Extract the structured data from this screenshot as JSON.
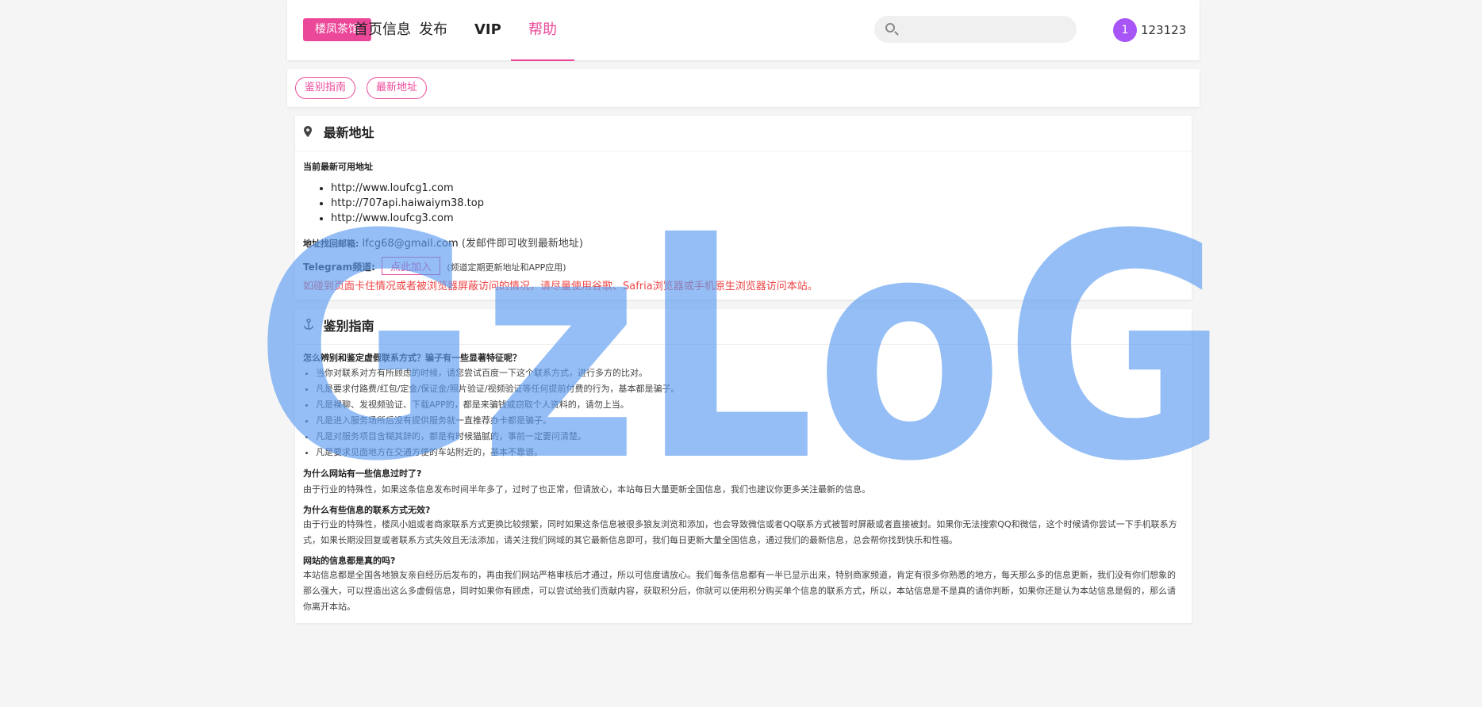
{
  "header": {
    "logo": "楼凤茶馆",
    "nav": [
      {
        "label": "首页信息"
      },
      {
        "label": "发布"
      },
      {
        "label": "VIP"
      },
      {
        "label": "帮助"
      }
    ],
    "search_placeholder": "",
    "avatar_badge": "1",
    "username": "123123"
  },
  "tabs": [
    "鉴别指南",
    "最新地址"
  ],
  "latest": {
    "title": "最新地址",
    "subtitle": "当前最新可用地址",
    "urls": [
      "http://www.loufcg1.com",
      "http://707api.haiwaiym38.top",
      "http://www.loufcg3.com"
    ],
    "email_label": "地址找回邮箱:",
    "email": "lfcg68@gmail.com",
    "email_note": "(发邮件即可收到最新地址)",
    "telegram_label": "Telegram频道:",
    "telegram_btn": "点此加入",
    "telegram_note": "(频道定期更新地址和APP应用)",
    "warning": "如碰到页面卡住情况或者被浏览器屏蔽访问的情况，请尽量使用谷歌、Safria浏览器或手机原生浏览器访问本站。"
  },
  "guide": {
    "title": "鉴别指南",
    "q1": "怎么辨别和鉴定虚假联系方式？骗子有一些显著特征呢？",
    "tips": [
      "当你对联系对方有所顾虑的时候，请您尝试百度一下这个联系方式，进行多方的比对。",
      "凡是要求付路费/红包/定金/保证金/照片验证/视频验证等任何提前付费的行为，基本都是骗子。",
      "凡是裸聊、发视频验证、下载APP的，都是来骗钱或窃取个人资料的，请勿上当。",
      "凡是进入服务场所后没有提供服务就一直推荐办卡都是骗子。",
      "凡是对服务项目含糊其辞的，都是有时候猫腻的，事前一定要问清楚。",
      "凡是要求见面地方在交通方便的车站附近的，基本不靠谱。"
    ],
    "q2": "为什么网站有一些信息过时了?",
    "a2": "由于行业的特殊性，如果这条信息发布时间半年多了，过时了也正常，但请放心，本站每日大量更新全国信息，我们也建议你更多关注最新的信息。",
    "q3": "为什么有些信息的联系方式无效?",
    "a3": "由于行业的特殊性，楼凤小姐或者商家联系方式更换比较频繁，同时如果这条信息被很多狼友浏览和添加，也会导致微信或者QQ联系方式被暂时屏蔽或者直接被封。如果你无法搜索QQ和微信，这个时候请你尝试一下手机联系方式，如果长期没回复或者联系方式失效且无法添加，请关注我们网域的其它最新信息即可，我们每日更新大量全国信息，通过我们的最新信息，总会帮你找到快乐和性福。",
    "q4": "网站的信息都是真的吗?",
    "a4": "本站信息都是全国各地狼友亲自经历后发布的，再由我们网站严格审核后才通过，所以可信度请放心。我们每条信息都有一半已显示出来，特别商家频道，肯定有很多你熟悉的地方，每天那么多的信息更新，我们没有你们想象的那么强大，可以捏造出这么多虚假信息，同时如果你有顾虑，可以尝试给我们贡献内容，获取积分后，你就可以使用积分购买单个信息的联系方式，所以，本站信息是不是真的请你判断，如果你还是认为本站信息是假的，那么请你离开本站。"
  },
  "watermark_text": "GzLoG",
  "colors": {
    "accent": "#ec4899",
    "avatar": "#a855f7",
    "warning": "#ef4444",
    "watermark": "#5b9bf0"
  }
}
